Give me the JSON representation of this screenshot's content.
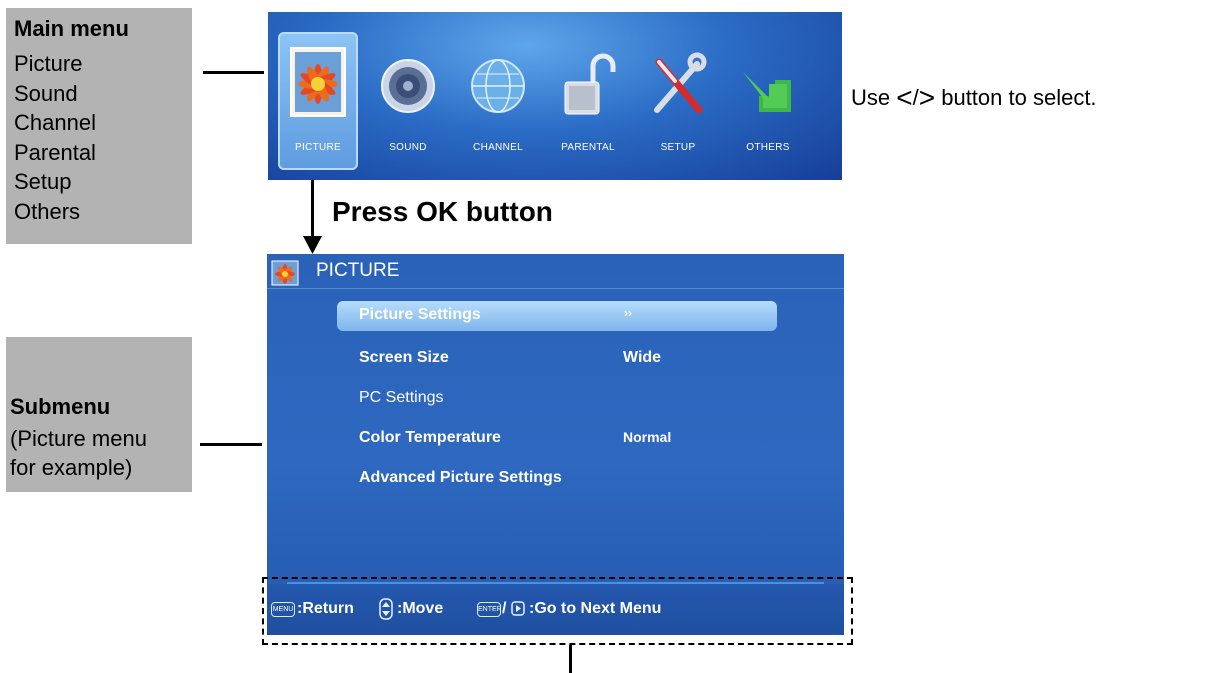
{
  "main_menu_label": {
    "title": "Main menu",
    "items": [
      "Picture",
      "Sound",
      "Channel",
      "Parental",
      "Setup",
      "Others"
    ]
  },
  "submenu_label": {
    "title": "Submenu",
    "desc_line1": "(Picture menu",
    "desc_line2": "for example)"
  },
  "menu_bar": {
    "items": [
      {
        "label": "PICTURE",
        "icon": "flower-picture-icon",
        "selected": true
      },
      {
        "label": "SOUND",
        "icon": "speaker-icon"
      },
      {
        "label": "CHANNEL",
        "icon": "globe-icon"
      },
      {
        "label": "PARENTAL",
        "icon": "padlock-icon"
      },
      {
        "label": "SETUP",
        "icon": "tools-icon"
      },
      {
        "label": "OTHERS",
        "icon": "green-arrow-icon"
      }
    ]
  },
  "use_instruction": {
    "prefix": "Use",
    "left_arrow": "<",
    "slash": "/",
    "right_arrow": ">",
    "suffix": "button to select."
  },
  "press_ok": "Press OK button",
  "submenu_panel": {
    "title": "PICTURE",
    "rows": [
      {
        "label": "Picture Settings",
        "value": "››",
        "selected": true
      },
      {
        "label": "Screen Size",
        "value": "Wide"
      },
      {
        "label": "PC Settings",
        "value": ""
      },
      {
        "label": "Color Temperature",
        "value": "Normal"
      },
      {
        "label": "Advanced Picture Settings",
        "value": ""
      }
    ],
    "footer": {
      "menu_key": "MENU",
      "return_text": ":Return",
      "move_text": ":Move",
      "enter_key": "ENTER",
      "next_text": ":Go to Next Menu"
    }
  },
  "colors": {
    "gray_label_bg": "#b3b3b3",
    "panel_blue": "#2e68c0",
    "highlight": "#8cc4f5"
  }
}
